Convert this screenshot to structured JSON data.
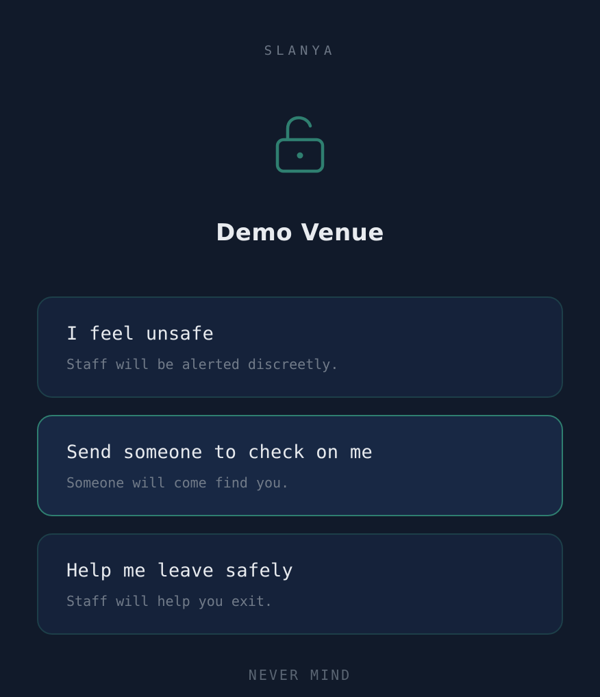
{
  "brand": {
    "name": "SLANYA"
  },
  "header": {
    "icon": "unlocked-padlock-icon",
    "venue_name": "Demo Venue"
  },
  "options": [
    {
      "title": "I feel unsafe",
      "subtitle": "Staff will be alerted discreetly.",
      "selected": false
    },
    {
      "title": "Send someone to check on me",
      "subtitle": "Someone will come find you.",
      "selected": true
    },
    {
      "title": "Help me leave safely",
      "subtitle": "Staff will help you exit.",
      "selected": false
    }
  ],
  "footer": {
    "cancel_label": "NEVER MIND"
  },
  "colors": {
    "background": "#111a2a",
    "card": "#15223a",
    "card_selected": "#182844",
    "accent": "#2f7f70",
    "border": "#1d3f49",
    "muted_text": "#717b89"
  }
}
